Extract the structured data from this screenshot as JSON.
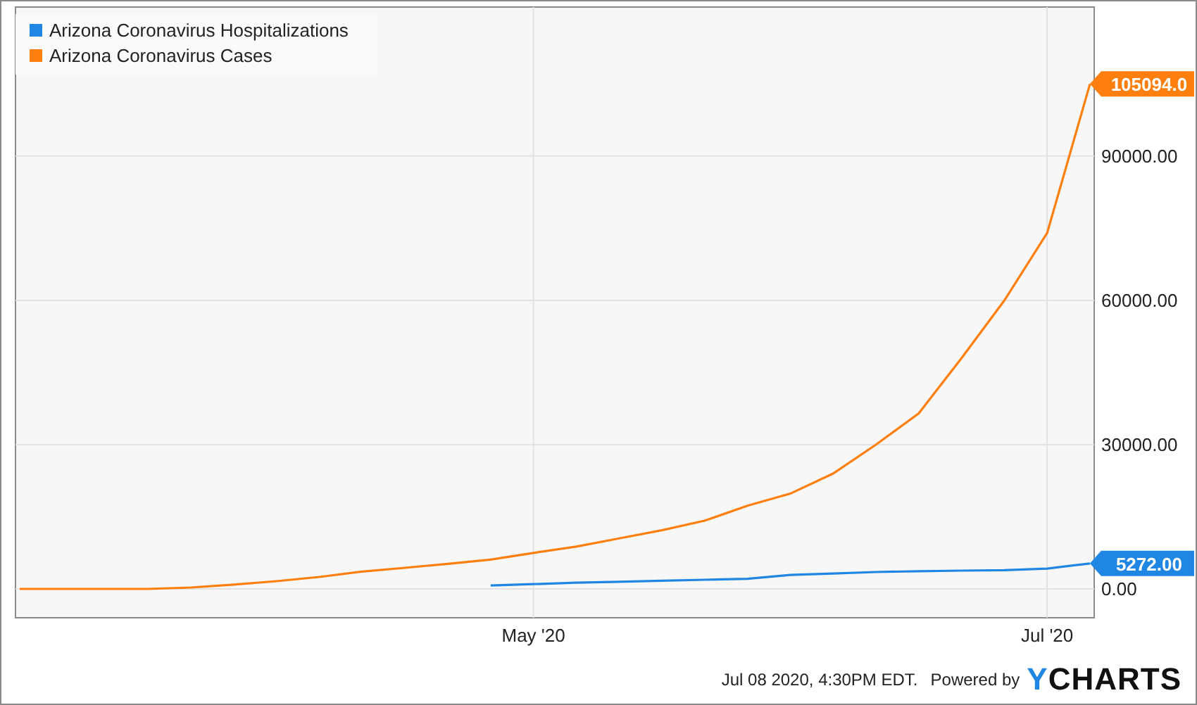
{
  "chart_data": {
    "type": "line",
    "categories": [
      null,
      null,
      null,
      null,
      null,
      null,
      null,
      null,
      null,
      null,
      null,
      null,
      "May '20",
      null,
      null,
      null,
      null,
      null,
      null,
      null,
      null,
      null,
      null,
      null,
      "Jul '20",
      null
    ],
    "series": [
      {
        "name": "Arizona Coronavirus Hospitalizations",
        "color": "#1f86e3",
        "values": [
          null,
          null,
          null,
          null,
          null,
          null,
          null,
          null,
          null,
          null,
          null,
          700,
          1000,
          1300,
          1500,
          1700,
          1900,
          2100,
          2900,
          3200,
          3500,
          3700,
          3800,
          3900,
          4200,
          5300
        ]
      },
      {
        "name": "Arizona Coronavirus Cases",
        "color": "#ff7f0e",
        "values": [
          0,
          0,
          0,
          0,
          300,
          900,
          1600,
          2500,
          3600,
          4400,
          5200,
          6100,
          7500,
          8800,
          10500,
          12200,
          14200,
          17300,
          19800,
          24000,
          30000,
          36500,
          48000,
          60000,
          74000,
          105000
        ]
      }
    ],
    "ylim": [
      -6000,
      121000
    ],
    "grid": true,
    "yticks": [
      {
        "value": 0,
        "label": "0.00"
      },
      {
        "value": 30000,
        "label": "30000.00"
      },
      {
        "value": 60000,
        "label": "60000.00"
      },
      {
        "value": 90000,
        "label": "90000.00"
      }
    ],
    "annotations": [
      "105094.0",
      "5272.00"
    ]
  },
  "footer": {
    "timestamp": "Jul 08 2020, 4:30PM EDT.",
    "powered_by": "Powered by",
    "logo_mark": "Y",
    "logo_text": "CHARTS"
  }
}
